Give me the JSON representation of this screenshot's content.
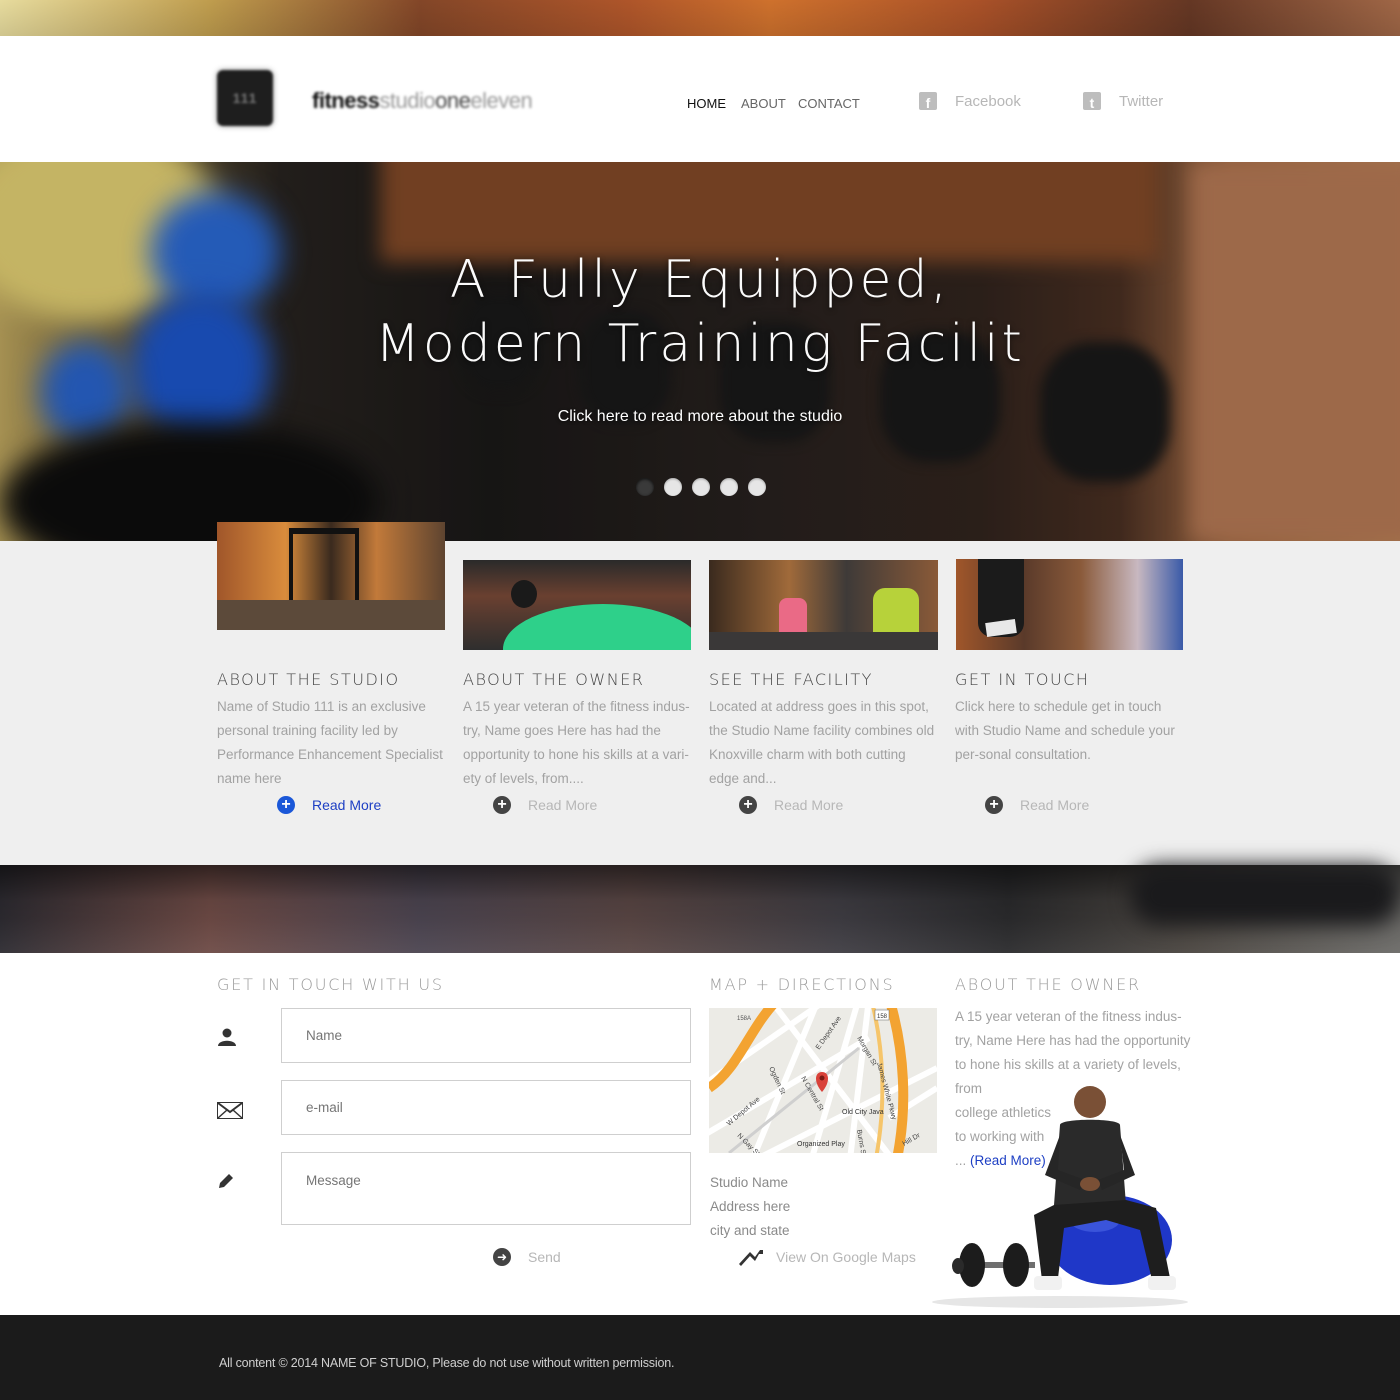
{
  "logo": {
    "icon_text": "111",
    "word_bold": "fitness",
    "word_light": "studio",
    "word_mid": "one",
    "word_end": "eleven"
  },
  "nav": {
    "home": "HOME",
    "about": "ABOUT",
    "contact": "CONTACT"
  },
  "social": {
    "facebook": "Facebook",
    "twitter": "Twitter",
    "facebook_glyph": "f",
    "twitter_glyph": "t"
  },
  "hero": {
    "title_line1": "A Fully Equipped,",
    "title_line2": "Modern Training Facilit",
    "link": "Click here to read more about the studio",
    "slide_count": 5,
    "active_slide": 1
  },
  "features": [
    {
      "title": "ABOUT THE STUDIO",
      "text": "Name of Studio 111 is an exclusive personal training facility led by Performance Enhancement Specialist name here",
      "readmore": "Read More",
      "active": true
    },
    {
      "title": "ABOUT THE OWNER",
      "text": "A 15 year veteran of the fitness indus-try, Name goes Here has had the opportunity to hone his skills at a vari-ety of levels, from....",
      "readmore": "Read More",
      "active": false
    },
    {
      "title": "SEE THE FACILITY",
      "text": "Located at address goes in this spot, the Studio Name facility combines old Knoxville charm with both cutting edge and...",
      "readmore": "Read More",
      "active": false
    },
    {
      "title": "GET IN TOUCH",
      "text": "Click here to schedule get in touch with Studio Name and schedule your per-sonal consultation.",
      "readmore": "Read More",
      "active": false
    }
  ],
  "contact": {
    "title": "GET IN TOUCH WITH US",
    "name_placeholder": "Name",
    "email_placeholder": "e-mail",
    "message_placeholder": "Message",
    "send": "Send"
  },
  "map": {
    "title": "MAP + DIRECTIONS",
    "labels": [
      "E Depot Ave",
      "N Central St",
      "Morgan St",
      "James White Pkwy",
      "W Depot Ave",
      "Ogden St",
      "N Gay St",
      "Old City Java",
      "Organized Play",
      "Burns St",
      "Hill Dr",
      "158",
      "158A"
    ],
    "studio_name": "Studio Name",
    "address": "Address here",
    "city": "city and state",
    "view_link": "View On Google Maps"
  },
  "owner": {
    "title": "ABOUT THE OWNER",
    "lines": [
      "A 15 year veteran of the fitness indus-",
      "try, Name Here has had the opportunity",
      "to hone his skills at a variety of levels,",
      "from",
      "college athletics",
      "to working with"
    ],
    "ellipsis": "...",
    "read_more": "(Read More)"
  },
  "footer": {
    "text": "All content © 2014 NAME OF STUDIO, Please do not use without written permission."
  },
  "colors": {
    "link_blue": "#1d3fc4",
    "footer_bg": "#1b1b1b",
    "section_gray": "#efefef"
  },
  "icons": [
    "facebook-icon",
    "twitter-icon",
    "plus-circle-icon",
    "user-icon",
    "envelope-icon",
    "pencil-icon",
    "arrow-right-circle-icon",
    "directions-arrow-icon",
    "map-pin-icon"
  ]
}
